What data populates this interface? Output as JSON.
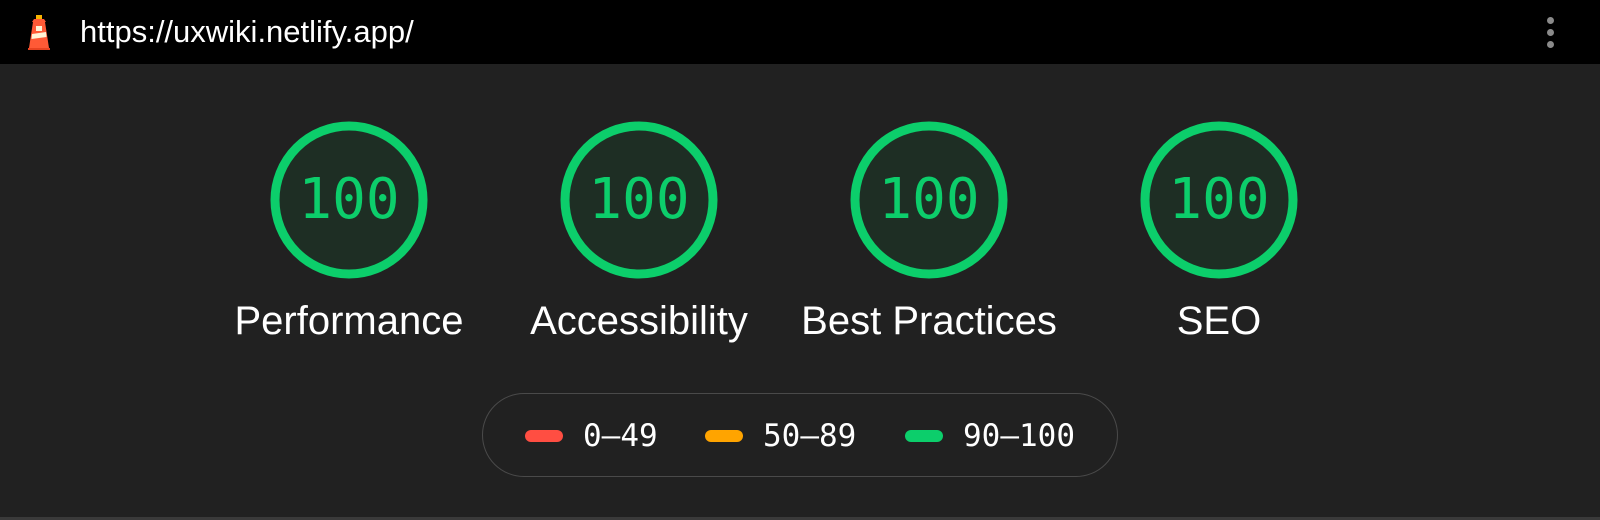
{
  "header": {
    "url": "https://uxwiki.netlify.app/",
    "logo_icon": "lighthouse-icon",
    "menu_icon": "more-vertical-icon"
  },
  "scores": [
    {
      "label": "Performance",
      "value": "100",
      "fraction": 1.0
    },
    {
      "label": "Accessibility",
      "value": "100",
      "fraction": 1.0
    },
    {
      "label": "Best Practices",
      "value": "100",
      "fraction": 1.0
    },
    {
      "label": "SEO",
      "value": "100",
      "fraction": 1.0
    }
  ],
  "legend": [
    {
      "range": "0–49",
      "color": "#ff4e42"
    },
    {
      "range": "50–89",
      "color": "#ffa400"
    },
    {
      "range": "90–100",
      "color": "#0cce6b"
    }
  ],
  "colors": {
    "pass": "#0cce6b",
    "pass_fill": "#1e2e24",
    "background": "#212121",
    "topbar": "#000000"
  }
}
